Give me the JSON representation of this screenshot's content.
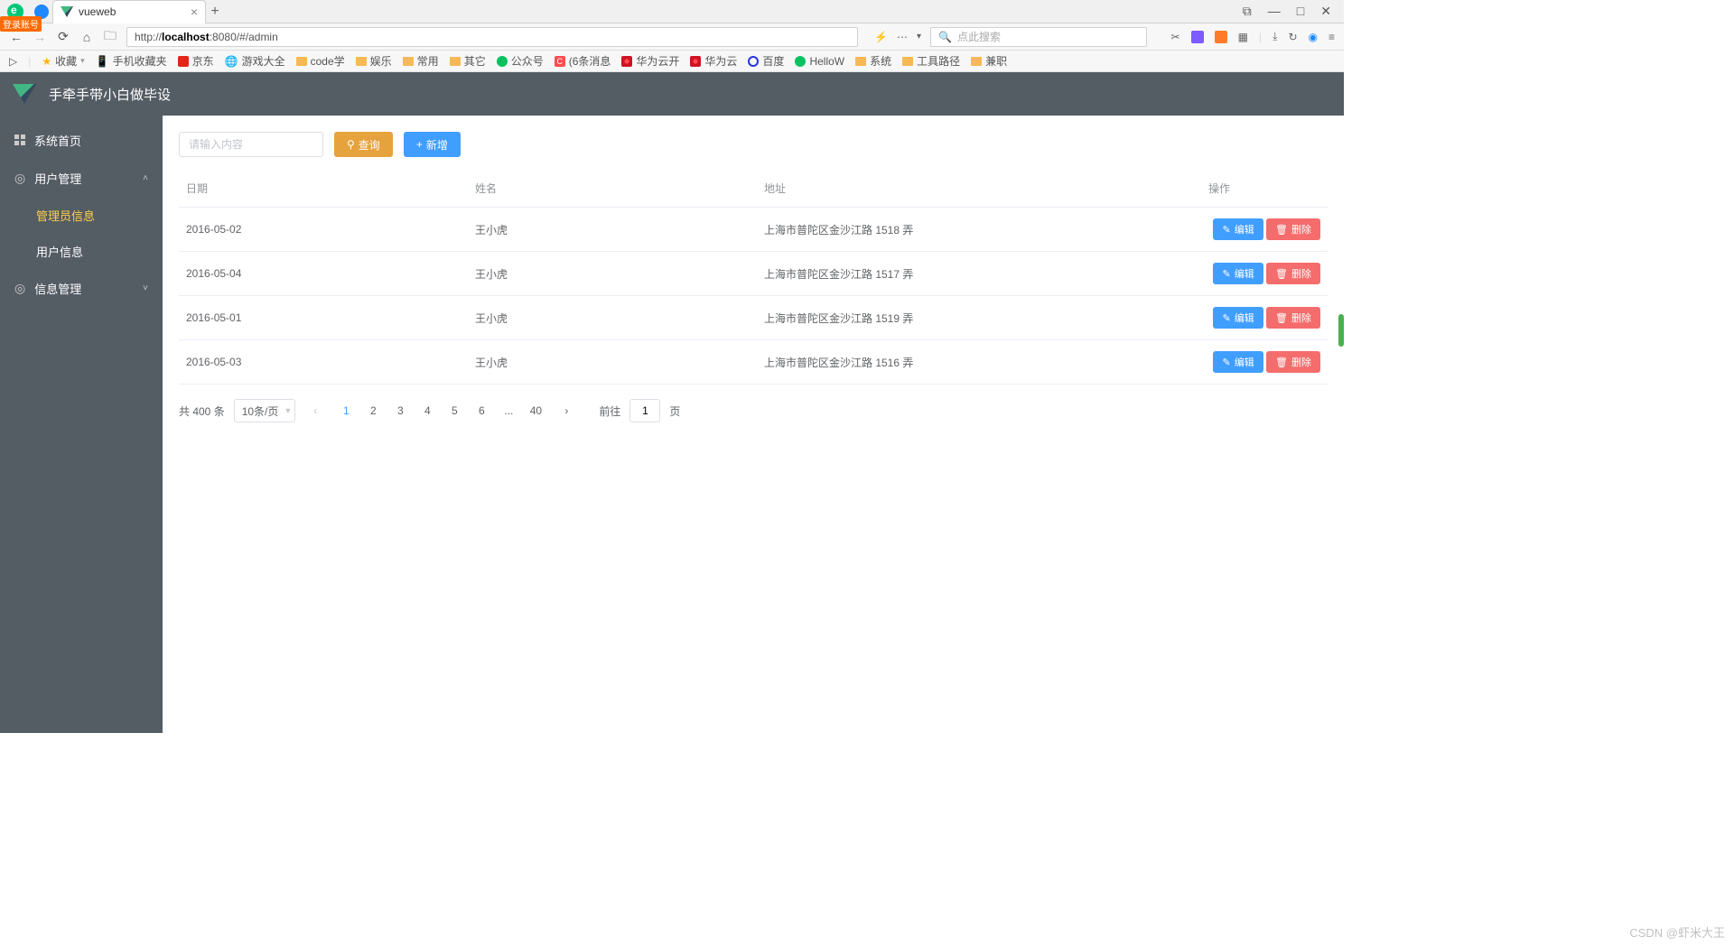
{
  "browser": {
    "login_tag": "登录账号",
    "tab_title": "vueweb",
    "window_controls": {
      "min": "—",
      "max": "□",
      "close": "✕",
      "extra": "⧉"
    },
    "url_prefix": "http://",
    "url_host": "localhost",
    "url_rest": ":8080/#/admin",
    "search_placeholder": "点此搜索",
    "bookmarks_label": "收藏",
    "bookmarks": [
      {
        "label": "手机收藏夹",
        "icon": "phone"
      },
      {
        "label": "京东",
        "icon": "jd"
      },
      {
        "label": "游戏大全",
        "icon": "globe"
      },
      {
        "label": "code学",
        "icon": "folder"
      },
      {
        "label": "娱乐",
        "icon": "folder"
      },
      {
        "label": "常用",
        "icon": "folder"
      },
      {
        "label": "其它",
        "icon": "folder"
      },
      {
        "label": "公众号",
        "icon": "wechat"
      },
      {
        "label": "(6条消息",
        "icon": "c"
      },
      {
        "label": "华为云开",
        "icon": "huawei"
      },
      {
        "label": "华为云",
        "icon": "huawei"
      },
      {
        "label": "百度",
        "icon": "baidu"
      },
      {
        "label": "HelloW",
        "icon": "green"
      },
      {
        "label": "系统",
        "icon": "folder"
      },
      {
        "label": "工具路径",
        "icon": "folder"
      },
      {
        "label": "兼职",
        "icon": "folder"
      }
    ]
  },
  "app": {
    "title": "手牵手带小白做毕设",
    "sidebar": {
      "home": "系统首页",
      "user_mgmt": "用户管理",
      "admin_info": "管理员信息",
      "user_info": "用户信息",
      "info_mgmt": "信息管理"
    },
    "toolbar": {
      "search_placeholder": "请输入内容",
      "query_label": "查询",
      "add_label": "新增"
    },
    "table": {
      "headers": {
        "date": "日期",
        "name": "姓名",
        "address": "地址",
        "ops": "操作"
      },
      "edit_label": "编辑",
      "delete_label": "删除",
      "rows": [
        {
          "date": "2016-05-02",
          "name": "王小虎",
          "address": "上海市普陀区金沙江路 1518 弄"
        },
        {
          "date": "2016-05-04",
          "name": "王小虎",
          "address": "上海市普陀区金沙江路 1517 弄"
        },
        {
          "date": "2016-05-01",
          "name": "王小虎",
          "address": "上海市普陀区金沙江路 1519 弄"
        },
        {
          "date": "2016-05-03",
          "name": "王小虎",
          "address": "上海市普陀区金沙江路 1516 弄"
        }
      ]
    },
    "pagination": {
      "total_text": "共 400 条",
      "page_size": "10条/页",
      "pages": [
        "1",
        "2",
        "3",
        "4",
        "5",
        "6",
        "...",
        "40"
      ],
      "active_page": "1",
      "goto_prefix": "前往",
      "goto_value": "1",
      "goto_suffix": "页"
    }
  },
  "watermark": "CSDN @虾米大王"
}
